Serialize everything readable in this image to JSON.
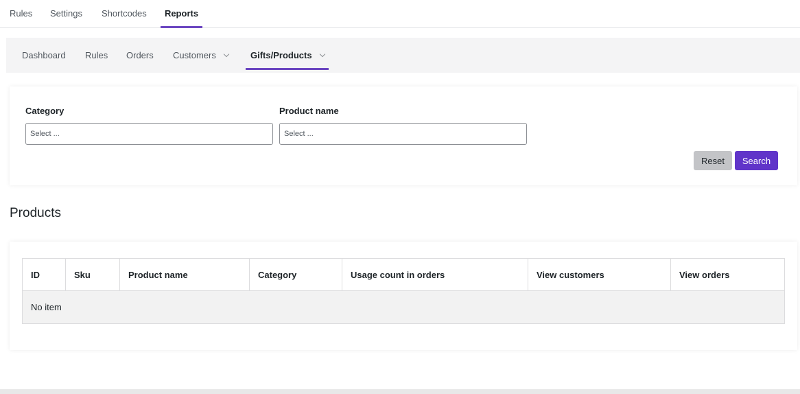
{
  "top_tabs": [
    {
      "label": "Rules"
    },
    {
      "label": "Settings"
    },
    {
      "label": "Shortcodes"
    },
    {
      "label": "Reports"
    }
  ],
  "sub_tabs": [
    {
      "label": "Dashboard"
    },
    {
      "label": "Rules"
    },
    {
      "label": "Orders"
    },
    {
      "label": "Customers"
    },
    {
      "label": "Gifts/Products"
    }
  ],
  "filters": {
    "category_label": "Category",
    "category_placeholder": "Select ...",
    "product_label": "Product name",
    "product_placeholder": "Select ...",
    "reset_label": "Reset",
    "search_label": "Search"
  },
  "products": {
    "title": "Products",
    "columns": [
      "ID",
      "Sku",
      "Product name",
      "Category",
      "Usage count in orders",
      "View customers",
      "View orders"
    ],
    "empty_text": "No item"
  },
  "colors": {
    "accent": "#6b46c1",
    "search_button": "#6034c9"
  }
}
